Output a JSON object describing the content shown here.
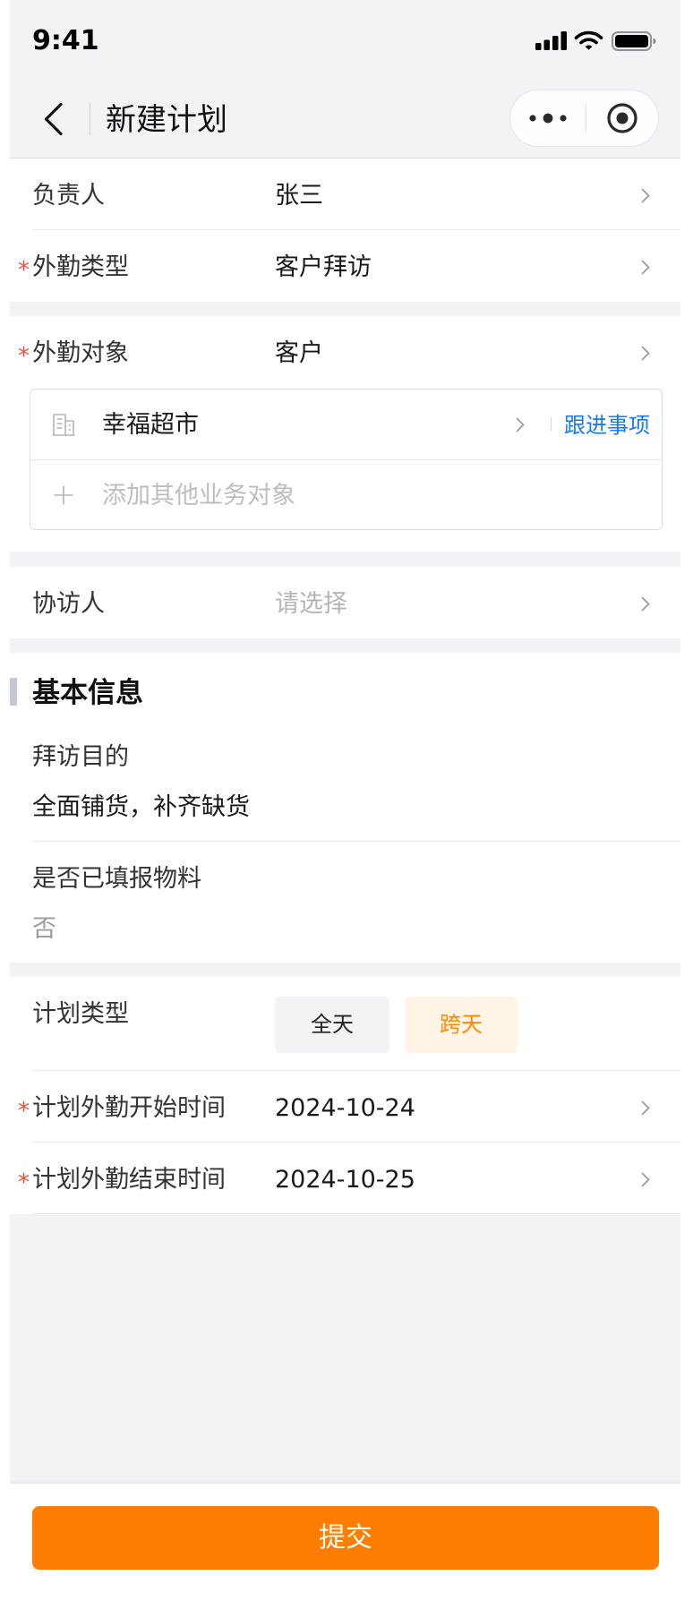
{
  "status_bar": {
    "time": "9:41",
    "icons": [
      "signal-icon",
      "wifi-icon",
      "battery-icon"
    ]
  },
  "nav": {
    "title": "新建计划",
    "back_icon": "chevron-left-icon",
    "capsule": {
      "more_icon": "more-dots-icon",
      "close_icon": "target-icon"
    }
  },
  "required_mark": "*",
  "form": {
    "owner": {
      "label": "负责人",
      "value": "张三"
    },
    "visit_type": {
      "label": "外勤类型",
      "value": "客户拜访",
      "required": true
    },
    "visit_target": {
      "label": "外勤对象",
      "value": "客户",
      "required": true,
      "objects": [
        {
          "icon": "building-icon",
          "name": "幸福超市",
          "action": "跟进事项"
        }
      ],
      "add_icon": "plus-icon",
      "add_placeholder": "添加其他业务对象"
    },
    "companion": {
      "label": "协访人",
      "placeholder": "请选择"
    }
  },
  "basic_info": {
    "title": "基本信息",
    "fields": [
      {
        "label": "拜访目的",
        "value": "全面铺货，补齐缺货"
      },
      {
        "label": "是否已填报物料",
        "value": "否"
      }
    ]
  },
  "plan": {
    "type": {
      "label": "计划类型",
      "options": [
        {
          "label": "全天",
          "selected": false
        },
        {
          "label": "跨天",
          "selected": true
        }
      ]
    },
    "start": {
      "label": "计划外勤开始时间",
      "value": "2024-10-24",
      "required": true
    },
    "end": {
      "label": "计划外勤结束时间",
      "value": "2024-10-25",
      "required": true
    }
  },
  "footer": {
    "submit_label": "提交"
  },
  "colors": {
    "accent": "#ff7d00",
    "accent_soft": "#fff4e5",
    "accent_text": "#ff8a00",
    "link": "#1677ff",
    "required": "#f04b3a",
    "page_bg": "#f2f3f5"
  }
}
